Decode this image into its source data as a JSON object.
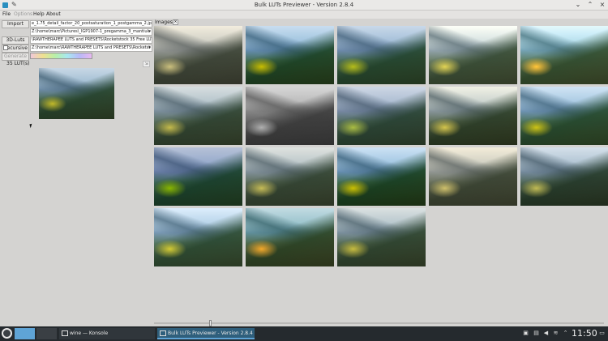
{
  "window": {
    "title": "Bulk LUTs Previewer - Version 2.8.4"
  },
  "menu": {
    "file": "File",
    "options": "Options",
    "help": "Help",
    "about": "About"
  },
  "left_panel": {
    "import_label": "Import",
    "import_path": "e_1.75_detail_factor_20_postsaturation_1_postgamma_2.jpg",
    "image_dir": "Z:\\home\\marc\\Pictures\\_IGP1907-1_pregamma_3_mantiuk",
    "luts_label": "3D-Luts",
    "luts_path": "\\RAWTHERAPEE LUTS and PRESETS\\Rocketstock 35 Free LUTs",
    "recursive_label": "Recursive",
    "recursive_checked": false,
    "recursive_path": "Z:\\home\\marc\\RAWTHERAPEE LUTS and PRESETS\\Rocketst",
    "generate_label": "Generate",
    "lut_count": "35 LUT(s)"
  },
  "images_tab": {
    "label": "Images",
    "close": "×"
  },
  "grid": {
    "filters": [
      "sepia(0.5) saturate(0.7)",
      "saturate(1.25) contrast(1.05)",
      "saturate(1.1) hue-rotate(5deg)",
      "sepia(0.3) brightness(1.12)",
      "brightness(1.15) hue-rotate(-15deg)",
      "saturate(0.85) sepia(0.15)",
      "grayscale(1)",
      "saturate(0.8) hue-rotate(10deg)",
      "sepia(0.35) contrast(1.1)",
      "saturate(1.15) brightness(1.05)",
      "saturate(1.3) hue-rotate(15deg) brightness(0.9)",
      "sepia(0.25) saturate(0.85)",
      "saturate(1.2) contrast(1.1)",
      "sepia(0.5) saturate(0.9)",
      "grayscale(0.35) contrast(1.1)",
      "saturate(0.95) brightness(1.1)",
      "hue-rotate(-20deg) saturate(1.1)",
      "sepia(0.2)"
    ]
  },
  "taskbar": {
    "konsole": "wine — Konsole",
    "bulk": "Bulk LUTs Previewer - Version 2.8.4",
    "clock": "11:50"
  }
}
